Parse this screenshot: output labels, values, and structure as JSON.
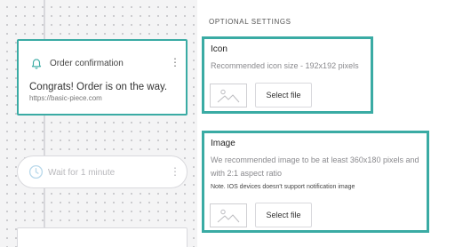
{
  "flow": {
    "notification_card": {
      "title": "Order confirmation",
      "body": "Congrats! Order is on the way.",
      "url": "https://basic-piece.com",
      "menu_glyph": "⋮",
      "icon": "bell-icon"
    },
    "wait_step": {
      "label": "Wait for 1 minute",
      "menu_glyph": "⋮",
      "icon": "clock-icon"
    }
  },
  "settings": {
    "section_label": "OPTIONAL SETTINGS",
    "icon_setting": {
      "heading": "Icon",
      "description": "Recommended icon size - 192x192 pixels",
      "select_label": "Select file",
      "placeholder_icon": "image-placeholder-icon"
    },
    "image_setting": {
      "heading": "Image",
      "description_line1": "We recommended image to be at least 360x180 pixels and",
      "description_line2": "with 2:1 aspect ratio",
      "note": "Note. IOS devices doesn't support notification image",
      "select_label": "Select file",
      "placeholder_icon": "image-placeholder-icon"
    }
  },
  "colors": {
    "accent": "#3aaba4",
    "canvas": "#f4f4f5"
  }
}
